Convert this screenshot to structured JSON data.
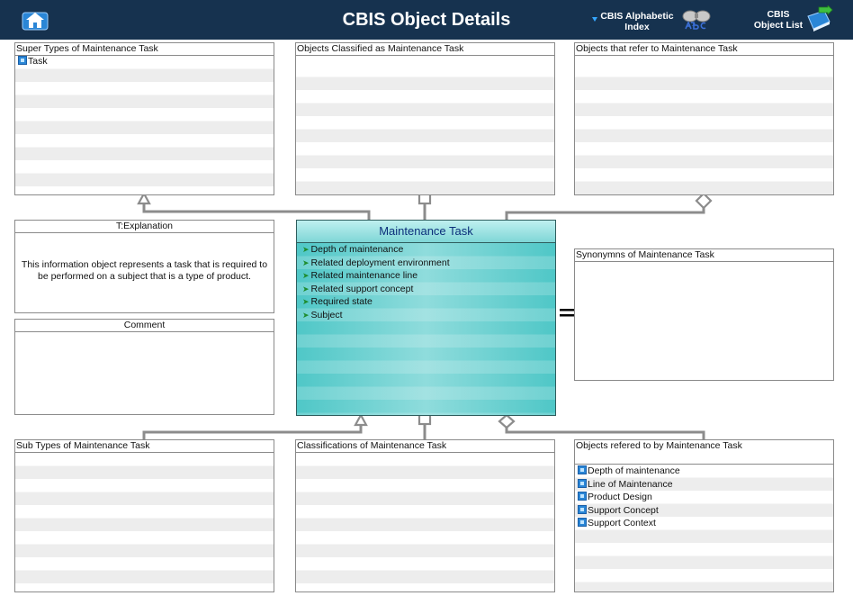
{
  "header": {
    "title": "CBIS Object Details",
    "alpha_index_label": "CBIS Alphabetic Index",
    "object_list_label": "CBIS Object List",
    "icons": [
      "home-icon",
      "binoculars-abc-icon",
      "book-arrow-icon"
    ],
    "background_color": "#16324f"
  },
  "panels": {
    "super_types": {
      "title": "Super Types of Maintenance Task",
      "items": [
        "Task"
      ]
    },
    "classified_as": {
      "title": "Objects Classified as  Maintenance Task",
      "items": []
    },
    "refer_to": {
      "title": "Objects that refer to   Maintenance Task",
      "items": []
    },
    "explanation": {
      "title": "T:Explanation",
      "text": "This information object represents a task that is required to be performed on a subject that is a type of product."
    },
    "comment": {
      "title": "Comment",
      "text": ""
    },
    "synonyms": {
      "title": "Synonymns  of Maintenance Task",
      "items": []
    },
    "sub_types": {
      "title": "Sub Types of Maintenance Task",
      "items": []
    },
    "classifications": {
      "title": "Classifications of Maintenance Task",
      "items": []
    },
    "referred_by": {
      "title": "Objects refered to by   Maintenance Task",
      "items": [
        "Depth of maintenance",
        "Line of Maintenance",
        "Product Design",
        "Support Concept",
        "Support Context"
      ]
    }
  },
  "main_object": {
    "title": "Maintenance Task",
    "attributes": [
      "Depth of maintenance",
      "Related deployment environment",
      "Related maintenance line",
      "Related support concept",
      "Required state",
      "Subject"
    ],
    "accent_color": "#4fc7c7"
  }
}
